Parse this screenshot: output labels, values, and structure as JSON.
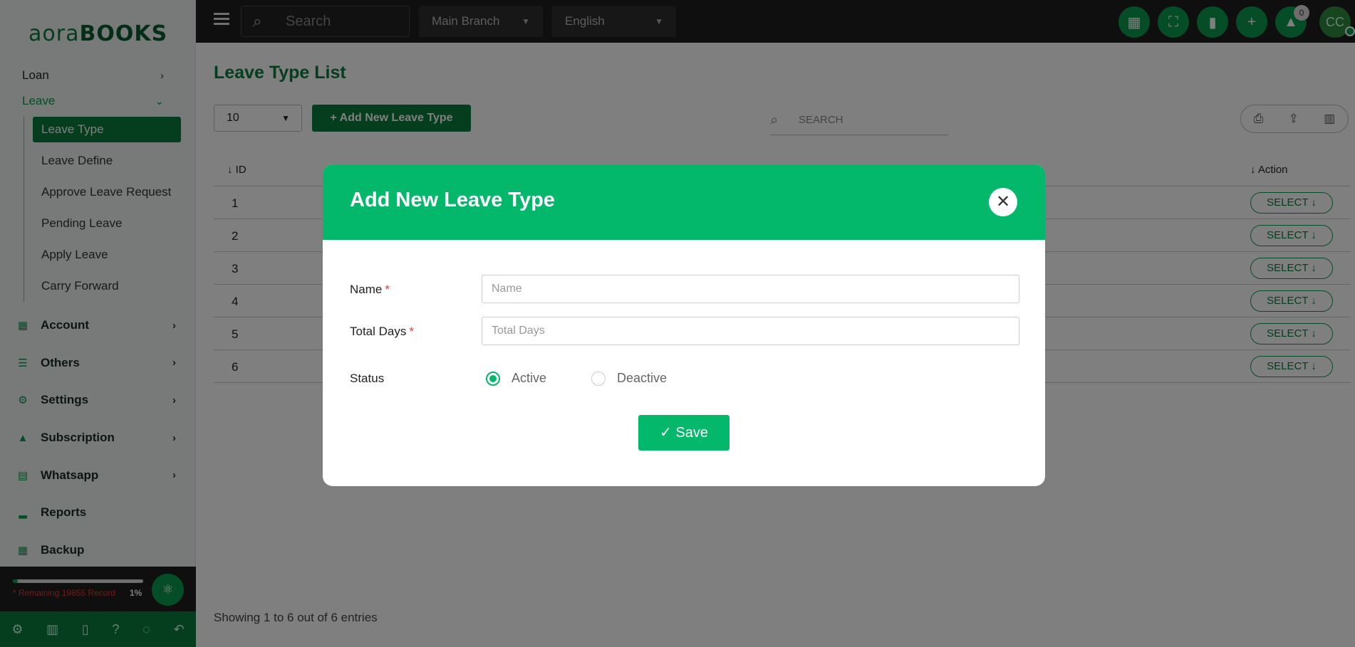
{
  "brand": {
    "logo_light": "aora",
    "logo_bold": "BOOKS"
  },
  "sidebar": {
    "sub_items": [
      {
        "label": "Loan",
        "chevron": "›"
      },
      {
        "label": "Leave",
        "chevron": "⌄"
      }
    ],
    "leave_items": [
      {
        "label": "Leave Type"
      },
      {
        "label": "Leave Define"
      },
      {
        "label": "Approve Leave Request"
      },
      {
        "label": "Pending Leave"
      },
      {
        "label": "Apply Leave"
      },
      {
        "label": "Carry Forward"
      }
    ],
    "main_items": [
      {
        "label": "Account",
        "icon": "calculator-icon",
        "glyph": "▦"
      },
      {
        "label": "Others",
        "icon": "list-icon",
        "glyph": "☰"
      },
      {
        "label": "Settings",
        "icon": "gear-icon",
        "glyph": "⚙"
      },
      {
        "label": "Subscription",
        "icon": "bell-icon",
        "glyph": "🔔"
      },
      {
        "label": "Whatsapp",
        "icon": "document-icon",
        "glyph": "▤"
      },
      {
        "label": "Reports",
        "icon": "signal-bars-icon",
        "glyph": "▂"
      },
      {
        "label": "Backup",
        "icon": "grid-icon",
        "glyph": "▦"
      }
    ],
    "usage": {
      "remaining": "* Remaining 19855 Record",
      "percent": "1%",
      "progress": 0.01
    }
  },
  "topbar": {
    "search_placeholder": "Search",
    "branch": "Main Branch",
    "language": "English",
    "notifications": "0",
    "avatar": "CC"
  },
  "main": {
    "title": "Leave Type List",
    "page_size": "10",
    "add_label": "+ Add New Leave Type",
    "search_placeholder": "SEARCH",
    "col_id": "↓ ID",
    "col_action": "↓ Action",
    "rows": [
      {
        "id": "1",
        "action": "SELECT ↓"
      },
      {
        "id": "2",
        "action": "SELECT ↓"
      },
      {
        "id": "3",
        "action": "SELECT ↓"
      },
      {
        "id": "4",
        "action": "SELECT ↓"
      },
      {
        "id": "5",
        "action": "SELECT ↓"
      },
      {
        "id": "6",
        "action": "SELECT ↓"
      }
    ],
    "showing": "Showing 1 to 6 out of 6 entries"
  },
  "modal": {
    "title": "Add New Leave Type",
    "name_label": "Name",
    "name_placeholder": "Name",
    "days_label": "Total Days",
    "days_placeholder": "Total Days",
    "required_mark": "*",
    "status_label": "Status",
    "status_active": "Active",
    "status_deactive": "Deactive",
    "save_label": "✓  Save"
  }
}
